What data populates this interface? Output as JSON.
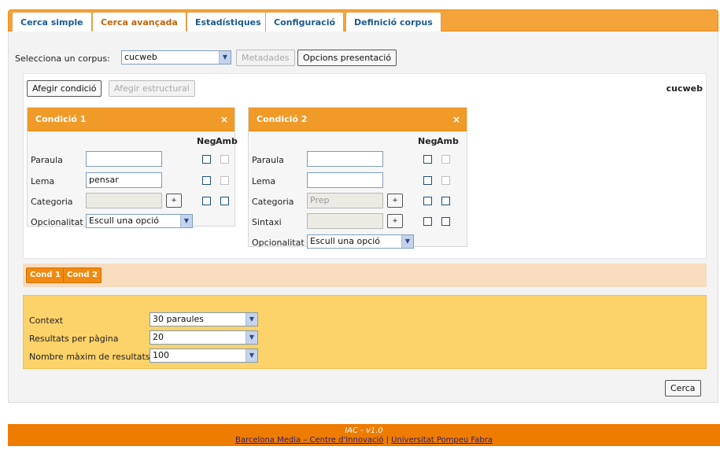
{
  "tabs": [
    {
      "label": "Cerca simple"
    },
    {
      "label": "Cerca avançada"
    },
    {
      "label": "Estadístiques"
    },
    {
      "label": "Configuració"
    },
    {
      "label": "Definició corpus"
    }
  ],
  "toolbar": {
    "corpus_label": "Selecciona un corpus:",
    "corpus_value": "cucweb",
    "metadata_button": "Metadades",
    "display_options_button": "Opcions presentació"
  },
  "conditions_area": {
    "add_condition_button": "Afegir condició",
    "add_structural_button": "Afegir estructural",
    "corpus_name": "cucweb",
    "neg_label": "Neg",
    "amb_label": "Amb",
    "condition1": {
      "title": "Condició 1",
      "close": "×",
      "word_label": "Paraula",
      "word_value": "",
      "lemma_label": "Lema",
      "lemma_value": "pensar",
      "category_label": "Categoria",
      "category_value": "",
      "plus": "+",
      "optionality_label": "Opcionalitat",
      "optionality_value": "Escull una opció"
    },
    "condition2": {
      "title": "Condició 2",
      "close": "×",
      "word_label": "Paraula",
      "word_value": "",
      "lemma_label": "Lema",
      "lemma_value": "",
      "category_label": "Categoria",
      "category_value": "Prep",
      "syntax_label": "Sintaxi",
      "syntax_value": "",
      "plus": "+",
      "optionality_label": "Opcionalitat",
      "optionality_value": "Escull una opció"
    },
    "chips": [
      {
        "label": "Cond 1"
      },
      {
        "label": "Cond 2"
      }
    ]
  },
  "settings": {
    "context_label": "Context",
    "context_value": "30 paraules",
    "per_page_label": "Resultats per pàgina",
    "per_page_value": "20",
    "max_results_label": "Nombre màxim de resultats",
    "max_results_value": "100"
  },
  "search_button": "Cerca",
  "footer": {
    "version": "IAC - v1.0",
    "link1": "Barcelona Media – Centre d'Innovació",
    "separator": "|",
    "link2": "Universitat Pompeu Fabra"
  },
  "colors": {
    "tab_bar": "#f4a43a",
    "condition_header": "#f09a28",
    "chips_bar": "#f8dcc0",
    "settings_panel": "#fcd26a",
    "footer": "#ee7c00"
  }
}
